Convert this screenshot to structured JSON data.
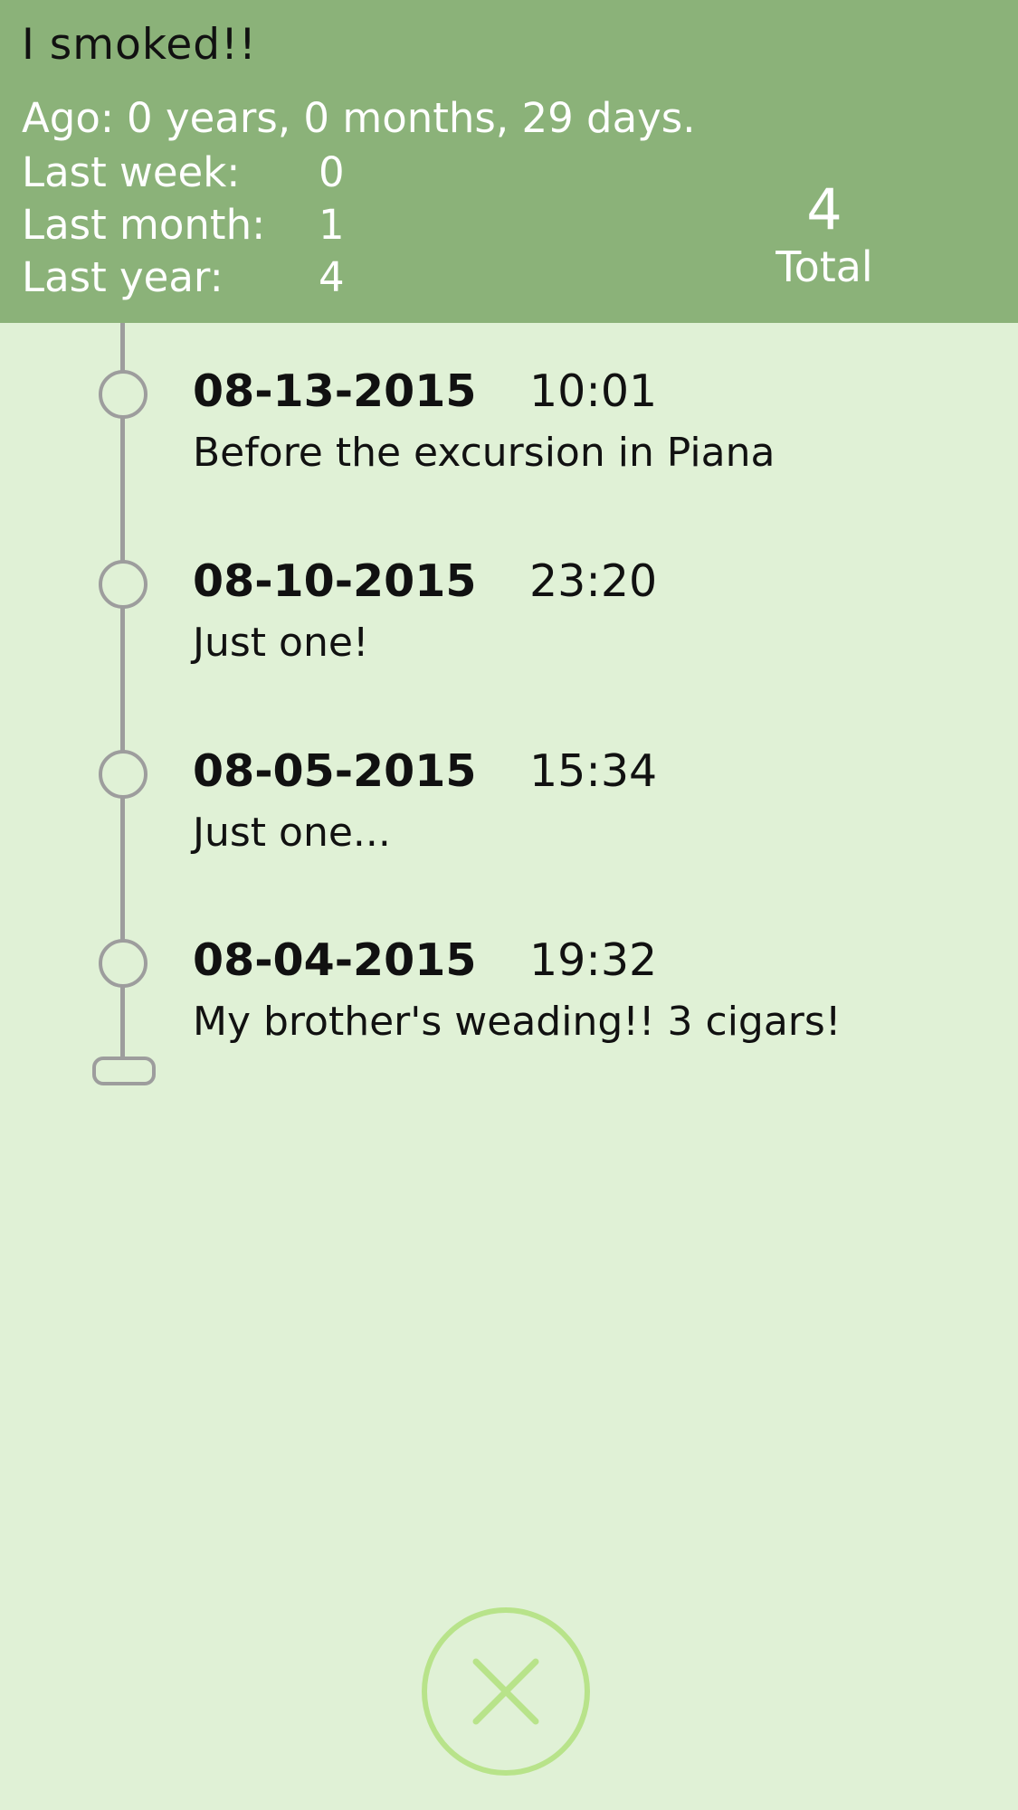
{
  "header": {
    "title": "I smoked!!",
    "ago_label": "Ago:",
    "ago_value": "0 years, 0 months, 29 days.",
    "stats": [
      {
        "label": "Last week:",
        "value": "0"
      },
      {
        "label": "Last month:",
        "value": "1"
      },
      {
        "label": "Last year:",
        "value": "4"
      }
    ],
    "total_value": "4",
    "total_label": "Total"
  },
  "entries": [
    {
      "date": "08-13-2015",
      "time": "10:01",
      "note": "Before the excursion in Piana"
    },
    {
      "date": "08-10-2015",
      "time": "23:20",
      "note": "Just one!"
    },
    {
      "date": "08-05-2015",
      "time": "15:34",
      "note": "Just one..."
    },
    {
      "date": "08-04-2015",
      "time": "19:32",
      "note": "My brother's weading!! 3 cigars!"
    }
  ],
  "colors": {
    "header_bg": "#8bb279",
    "page_bg": "#e0f1d6",
    "timeline": "#9d9d9d",
    "close_accent": "#b8e38a"
  },
  "icons": {
    "close": "close-icon"
  }
}
